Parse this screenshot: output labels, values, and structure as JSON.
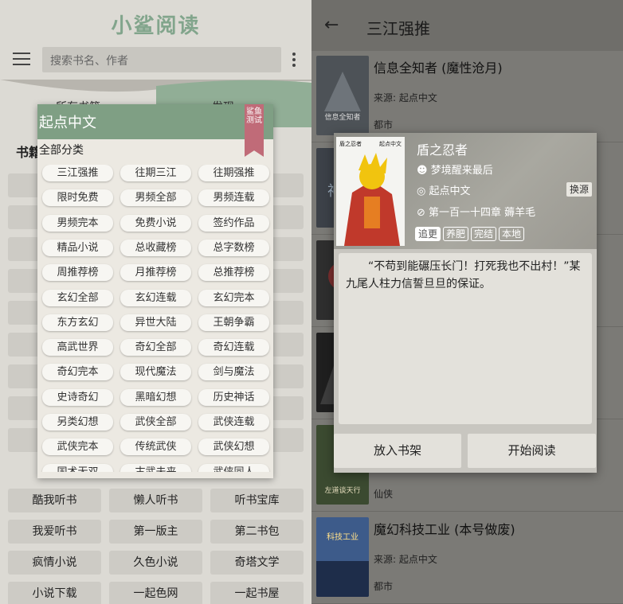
{
  "left": {
    "logo": "小鲨阅读",
    "search_placeholder": "搜索书名、作者",
    "tabs": [
      "所有书籍",
      "发现"
    ],
    "section_title": "书籍",
    "bg_items": [
      "酷我听书",
      "懒人听书",
      "听书宝库",
      "我爱听书",
      "第一版主",
      "第二书包",
      "疯情小说",
      "久色小说",
      "奇塔文学",
      "小说下载",
      "一起色网",
      "一起书屋"
    ],
    "dialog": {
      "title": "起点中文",
      "ribbon": "鲨鱼测试",
      "subtitle": "全部分类",
      "items": [
        "三江强推",
        "往期三江",
        "往期强推",
        "限时免费",
        "男频全部",
        "男频连载",
        "男频完本",
        "免费小说",
        "签约作品",
        "精品小说",
        "总收藏榜",
        "总字数榜",
        "周推荐榜",
        "月推荐榜",
        "总推荐榜",
        "玄幻全部",
        "玄幻连载",
        "玄幻完本",
        "东方玄幻",
        "异世大陆",
        "王朝争霸",
        "高武世界",
        "奇幻全部",
        "奇幻连载",
        "奇幻完本",
        "现代魔法",
        "剑与魔法",
        "史诗奇幻",
        "黑暗幻想",
        "历史神话",
        "另类幻想",
        "武侠全部",
        "武侠连载",
        "武侠完本",
        "传统武侠",
        "武侠幻想",
        "国术无双",
        "古武未来",
        "武侠同人"
      ]
    }
  },
  "right": {
    "title": "三江强推",
    "books": [
      {
        "title": "信息全知者 (魔性沧月)",
        "source": "来源: 起点中文",
        "tag": "都市",
        "cover_text": "信息全知者"
      },
      {
        "title": "",
        "source": "",
        "tag": "",
        "cover_text": "神"
      },
      {
        "title": "",
        "source": "",
        "tag": "",
        "cover_text": ""
      },
      {
        "title": "",
        "source": "",
        "tag": "",
        "cover_text": ""
      },
      {
        "title": "",
        "source": "",
        "tag": "仙侠",
        "cover_text": "左道谈天行"
      },
      {
        "title": "魔幻科技工业 (本号做废)",
        "source": "来源: 起点中文",
        "tag": "都市",
        "cover_text": "科技工业"
      }
    ],
    "popup": {
      "name": "盾之忍者",
      "author": "梦境醒来最后",
      "source": "起点中文",
      "latest": "第一百一十四章 薅羊毛",
      "swap": "换源",
      "tags": [
        "追更",
        "养肥",
        "完结",
        "本地"
      ],
      "cover_left": "盾之忍者",
      "cover_right": "起点中文",
      "intro": "“不苟到能碾压长门！打死我也不出村！”某九尾人柱力信誓旦旦的保证。",
      "btn_shelf": "放入书架",
      "btn_read": "开始阅读"
    }
  }
}
